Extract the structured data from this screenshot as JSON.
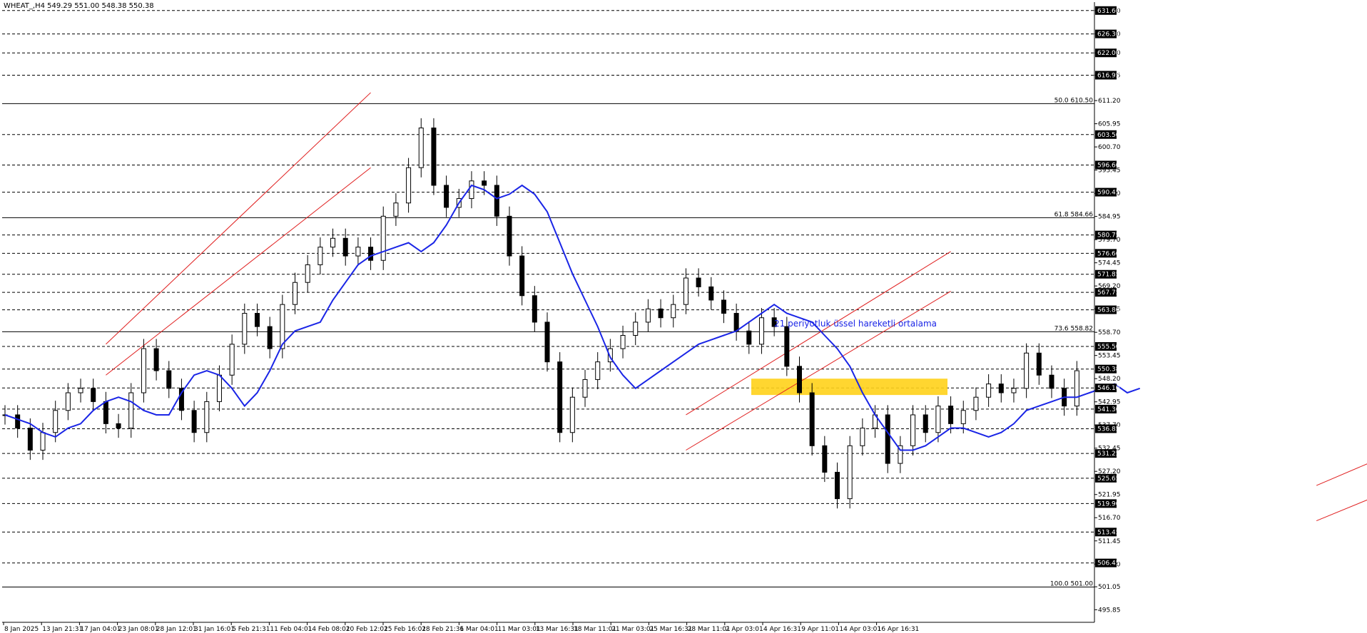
{
  "header": {
    "symbol_line": "WHEAT_,H4  549.29 551.00 548.38 550.38"
  },
  "annotation": {
    "ema_text": "21 periyotluk üssel hareketli ortalama"
  },
  "colors": {
    "background": "#ffffff",
    "candle": "#000000",
    "ema": "#1a25e6",
    "channel": "#e02020",
    "zone": "#ffd21a",
    "grid": "#000000"
  },
  "chart_data": {
    "type": "line",
    "title": "WHEAT_,H4",
    "ohlc_last": {
      "open": 549.29,
      "high": 551.0,
      "low": 548.38,
      "close": 550.38
    },
    "y_axis": {
      "range": [
        493.0,
        633.5
      ],
      "tick_labels": [
        "631.60",
        "626.30",
        "622.00",
        "616.95",
        "611.20",
        "605.95",
        "600.70",
        "595.45",
        "590.20",
        "584.95",
        "579.70",
        "574.45",
        "569.20",
        "563.95",
        "558.70",
        "553.45",
        "548.20",
        "542.95",
        "537.70",
        "532.45",
        "527.20",
        "521.95",
        "516.70",
        "511.45",
        "506.20",
        "501.05",
        "495.85"
      ],
      "level_labels": [
        "631.60",
        "626.30",
        "622.00",
        "616.95",
        "603.50",
        "596.60",
        "590.45",
        "580.75",
        "576.60",
        "571.85",
        "567.75",
        "563.80",
        "555.50",
        "550.38",
        "546.10",
        "541.30",
        "536.85",
        "531.25",
        "525.65",
        "519.90",
        "513.45",
        "506.45"
      ],
      "fib_levels": [
        {
          "label": "50.0 610.50",
          "value": 610.5
        },
        {
          "label": "61.8 584.66",
          "value": 584.66
        },
        {
          "label": "73.6 558.82",
          "value": 558.82
        },
        {
          "label": "100.0 501.00",
          "value": 501.0
        }
      ]
    },
    "x_axis": {
      "tick_labels": [
        "8 Jan 2025",
        "13 Jan 21:31",
        "17 Jan 04:01",
        "23 Jan 08:01",
        "28 Jan 12:01",
        "31 Jan 16:01",
        "5 Feb 21:31",
        "11 Feb 04:01",
        "14 Feb 08:01",
        "20 Feb 12:01",
        "25 Feb 16:01",
        "28 Feb 21:31",
        "6 Mar 04:01",
        "11 Mar 03:01",
        "13 Mar 16:31",
        "18 Mar 11:01",
        "21 Mar 03:01",
        "25 Mar 16:31",
        "28 Mar 11:01",
        "2 Apr 03:01",
        "4 Apr 16:31",
        "9 Apr 11:01",
        "14 Apr 03:01",
        "16 Apr 16:31"
      ]
    },
    "series": [
      {
        "name": "21 periyotluk üssel hareketli ortalama",
        "type": "line",
        "values": [
          540,
          539,
          538,
          536,
          535,
          537,
          538,
          541,
          543,
          544,
          543,
          541,
          540,
          540,
          545,
          549,
          550,
          549,
          546,
          542,
          545,
          550,
          556,
          559,
          560,
          561,
          566,
          570,
          574,
          576,
          577,
          578,
          579,
          577,
          579,
          583,
          588,
          592,
          591,
          589,
          590,
          592,
          590,
          586,
          579,
          572,
          566,
          560,
          553,
          549,
          546,
          548,
          550,
          552,
          554,
          556,
          557,
          558,
          559,
          561,
          563,
          565,
          563,
          562,
          561,
          558,
          555,
          551,
          545,
          540,
          536,
          532,
          532,
          533,
          535,
          537,
          537,
          536,
          535,
          536,
          538,
          541,
          542,
          543,
          544,
          544,
          545,
          546,
          547,
          545,
          546
        ]
      },
      {
        "name": "",
        "type": "candlestick",
        "closes": [
          540,
          537,
          532,
          536,
          541,
          545,
          546,
          543,
          538,
          537,
          545,
          555,
          550,
          546,
          541,
          536,
          543,
          549,
          556,
          563,
          560,
          555,
          565,
          570,
          574,
          578,
          580,
          576,
          578,
          575,
          585,
          588,
          596,
          605,
          592,
          587,
          589,
          593,
          592,
          585,
          576,
          567,
          561,
          552,
          536,
          544,
          548,
          552,
          555,
          558,
          561,
          564,
          562,
          565,
          571,
          569,
          566,
          563,
          559,
          556,
          562,
          560,
          551,
          545,
          533,
          527,
          521,
          533,
          537,
          540,
          529,
          533,
          540,
          536,
          542,
          538,
          541,
          544,
          547,
          545,
          546,
          554,
          549,
          546,
          542,
          550
        ]
      }
    ],
    "channels": [
      {
        "upper": [
          [
            8,
            556
          ],
          [
            29,
            613
          ]
        ],
        "lower": [
          [
            8,
            549
          ],
          [
            29,
            596
          ]
        ]
      },
      {
        "upper": [
          [
            54,
            540
          ],
          [
            75,
            577
          ]
        ],
        "lower": [
          [
            54,
            532
          ],
          [
            75,
            568
          ]
        ]
      },
      {
        "upper": [
          [
            104,
            524
          ],
          [
            150,
            580
          ]
        ],
        "lower": [
          [
            104,
            516
          ],
          [
            150,
            570
          ]
        ]
      }
    ],
    "zone": {
      "low": 544.5,
      "high": 548.2
    },
    "grid": true
  }
}
